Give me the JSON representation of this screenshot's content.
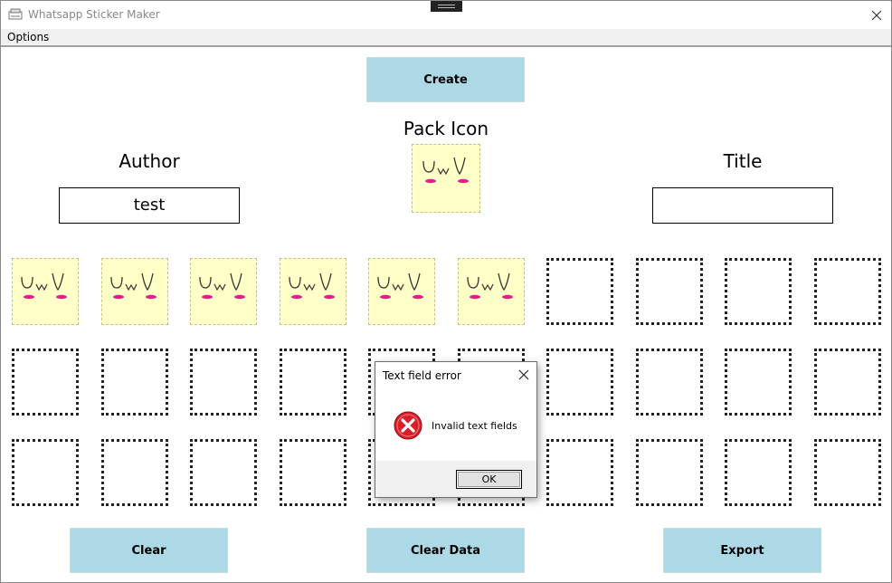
{
  "window": {
    "title": "Whatsapp Sticker Maker"
  },
  "menu": {
    "options_label": "Options"
  },
  "buttons": {
    "create": "Create",
    "clear": "Clear",
    "clear_data": "Clear Data",
    "export": "Export"
  },
  "fields": {
    "author_label": "Author",
    "author_value": "test",
    "pack_icon_label": "Pack Icon",
    "title_label": "Title",
    "title_value": ""
  },
  "sticker_grid": {
    "rows": 3,
    "columns": 10,
    "filled_count": 6,
    "sticker_icon": "uwu-face-sticker"
  },
  "dialog": {
    "title": "Text field error",
    "message": "Invalid text fields",
    "ok_label": "OK",
    "icon": "error-icon"
  },
  "colors": {
    "button_bg": "#add8e6",
    "sticker_bg": "#ffffc8",
    "error_red": "#d9202a"
  }
}
